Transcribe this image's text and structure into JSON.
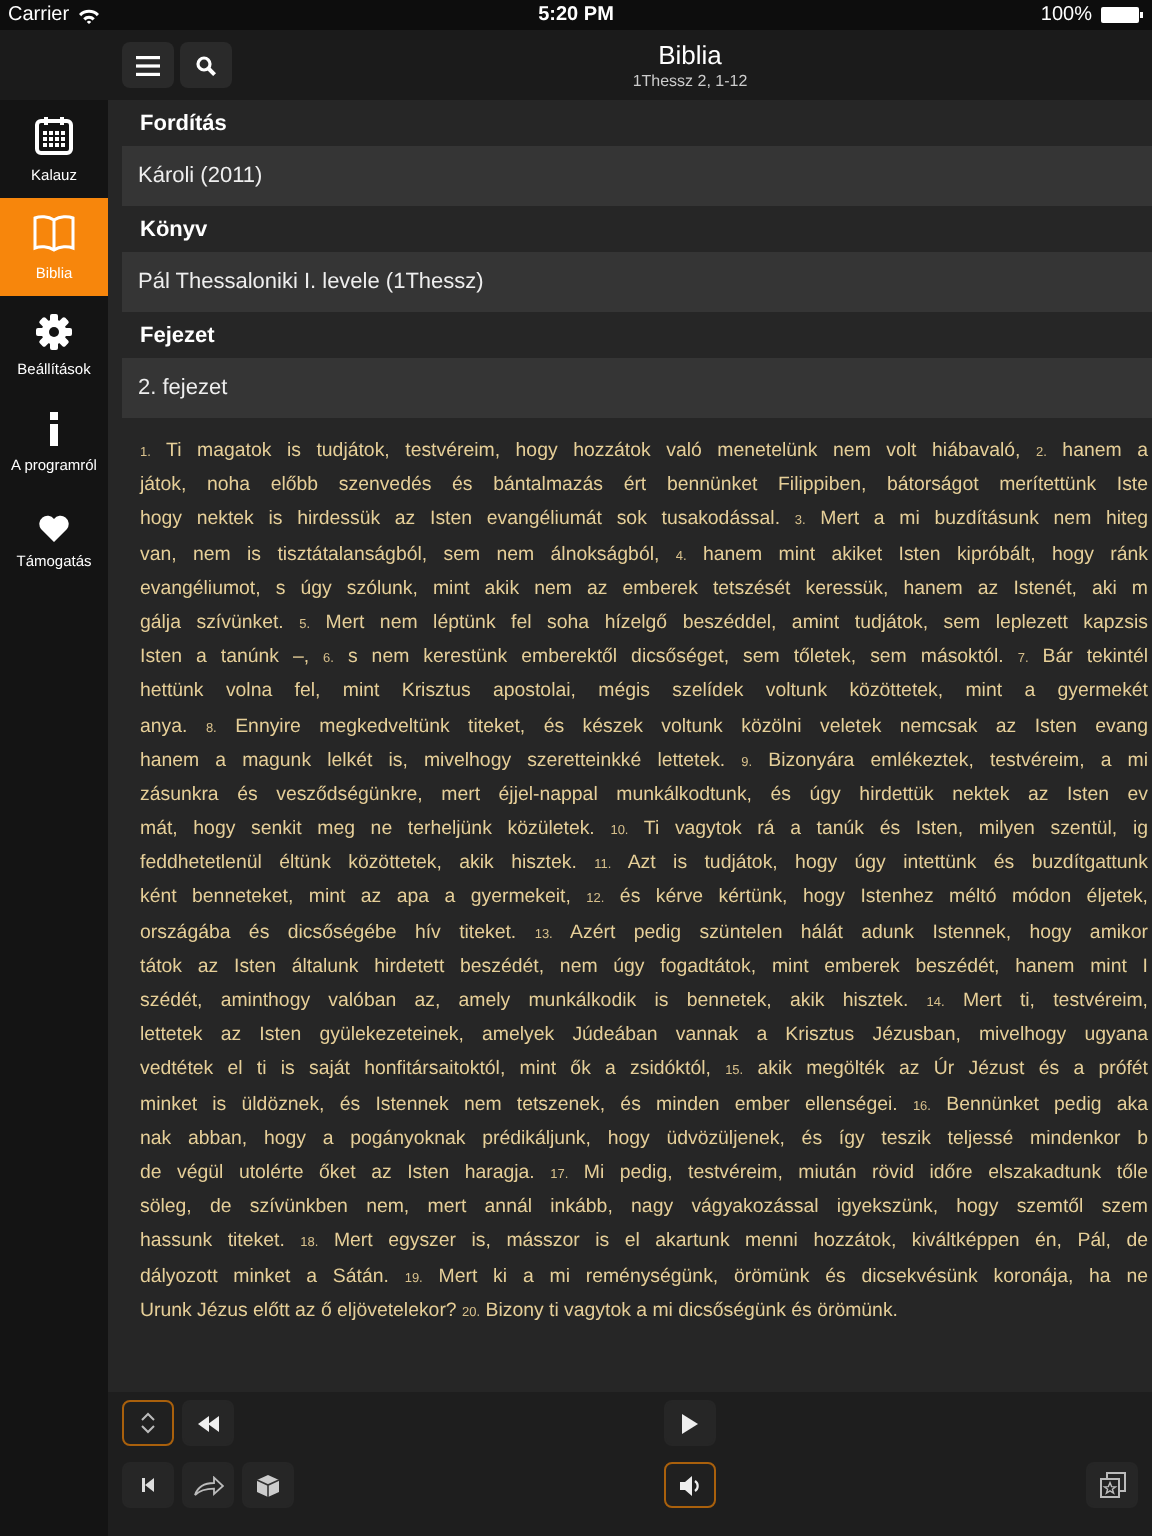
{
  "status_bar": {
    "carrier": "Carrier",
    "time": "5:20 PM",
    "battery": "100%"
  },
  "title": "Biblia",
  "subtitle": "1Thessz 2, 1-12",
  "sidebar": {
    "items": [
      {
        "label": "Kalauz",
        "kind": "calendar",
        "selected": false
      },
      {
        "label": "Biblia",
        "kind": "book",
        "selected": true
      },
      {
        "label": "Beállítások",
        "kind": "settings",
        "selected": false
      },
      {
        "label": "A programról",
        "kind": "about",
        "selected": false
      },
      {
        "label": "Támogatás",
        "kind": "support",
        "selected": false
      }
    ]
  },
  "sections": [
    {
      "heading": "Fordítás",
      "value": "Károli (2011)"
    },
    {
      "heading": "Könyv",
      "value": "Pál Thessaloniki I. levele (1Thessz)"
    },
    {
      "heading": "Fejezet",
      "value": "2. fejezet"
    }
  ],
  "text_lines": [
    "$_{1.}$ Ti magatok is tudjátok, testvéreim, hogy hozzátok való menetelünk nem volt hiábavaló, $_{2.}$ hanem a",
    "játok, noha előbb szenvedés és bántalmazás ért bennünket Filippiben, bátorságot merítettünk Iste",
    "hogy nektek is hirdessük az Isten evangéliumát sok tusakodással. $_{3.}$ Mert a mi buzdításunk nem hiteg",
    "van, nem is tisztátalanságból, sem nem álnokságból, $_{4.}$ hanem mint akiket Isten kipróbált, hogy ránk",
    "evangéliumot, s úgy szólunk, mint akik nem az emberek tetszését keressük, hanem az Istenét, aki m",
    "gálja szívünket. $_{5.}$ Mert nem léptünk fel soha hízelgő beszéddel, amint tudjátok, sem leplezett kapzsis",
    "Isten a tanúnk –, $_{6.}$ s nem kerestünk emberektől dicsőséget, sem tőletek, sem másoktól. $_{7.}$ Bár tekintél",
    "hettünk volna fel, mint Krisztus apostolai, mégis szelídek voltunk közöttetek, mint a gyermekét",
    "anya. $_{8.}$ Ennyire megkedveltünk titeket, és készek voltunk közölni veletek nemcsak az Isten evang",
    "hanem a magunk lelkét is, mivelhogy szeretteinkké lettetek. $_{9.}$ Bizonyára emlékeztek, testvéreim, a mi",
    "zásunkra és vesződségünkre, mert éjjel-nappal munkálkodtunk, és úgy hirdettük nektek az Isten ev",
    "mát, hogy senkit meg ne terheljünk közületek. $_{10.}$ Ti vagytok rá a tanúk és Isten, milyen szentül, ig",
    "feddhetetlenül éltünk közöttetek, akik hisztek. $_{11.}$ Azt is tudjátok, hogy úgy intettünk és buzdítgattunk",
    "ként benneteket, mint az apa a gyermekeit, $_{12.}$ és kérve kértünk, hogy Istenhez méltó módon éljetek,",
    "országába és dicsőségébe hív titeket. $_{13.}$ Azért pedig szüntelen hálát adunk Istennek, hogy amikor",
    "tátok az Isten általunk hirdetett beszédét, nem úgy fogadtátok, mint emberek beszédét, hanem mint I",
    "szédét, aminthogy valóban az, amely munkálkodik is bennetek, akik hisztek. $_{14.}$ Mert ti, testvéreim,",
    "lettetek az Isten gyülekezeteinek, amelyek Júdeában vannak a Krisztus Jézusban, mivelhogy ugyana",
    "vedtétek el ti is saját honfitársaitoktól, mint ők a zsidóktól, $_{15.}$ akik megölték az Úr Jézust és a prófét",
    "minket is üldöznek, és Istennek nem tetszenek, és minden ember ellenségei. $_{16.}$ Bennünket pedig aka",
    "nak abban, hogy a pogányoknak prédikáljunk, hogy üdvözüljenek, és így teszik teljessé mindenkor b",
    "de végül utolérte őket az Isten haragja. $_{17.}$ Mi pedig, testvéreim, miután rövid időre elszakadtunk tőle",
    "söleg, de szívünkben nem, mert annál inkább, nagy vágyakozással igyekszünk, hogy szemtől szem",
    "hassunk titeket. $_{18.}$ Mert egyszer is, másszor is el akartunk menni hozzátok, kiváltképpen én, Pál, de",
    "dályozott minket a Sátán. $_{19.}$ Mert ki a mi reménységünk, örömünk és dicsekvésünk koronája, ha ne",
    "Urunk Jézus előtt az ő eljövetelekor? $_{20.}$ Bizony ti vagytok a mi dicsőségünk és örömünk."
  ],
  "toolbar_rows": [
    [
      {
        "kind": "updown",
        "on": true
      },
      {
        "kind": "rewind",
        "on": false
      },
      {
        "kind": "spacer"
      },
      {
        "kind": "play",
        "on": false
      },
      {
        "kind": "spacer"
      }
    ],
    [
      {
        "kind": "first",
        "on": false
      },
      {
        "kind": "share",
        "on": false
      },
      {
        "kind": "cube",
        "on": false
      },
      {
        "kind": "spacer"
      },
      {
        "kind": "speaker",
        "on": true
      },
      {
        "kind": "spacer"
      },
      {
        "kind": "bookmarks",
        "on": false
      }
    ]
  ]
}
